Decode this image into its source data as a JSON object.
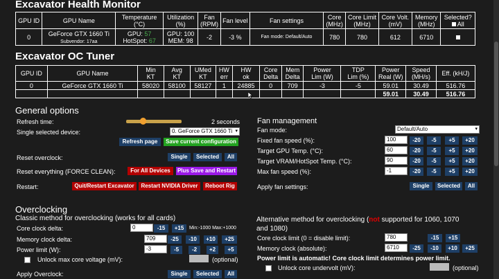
{
  "health": {
    "title": "Excavator Health Monitor",
    "headers": [
      "GPU ID",
      "GPU Name",
      "Temperature",
      "(°C)",
      "Utilization",
      "(%)",
      "Fan",
      "(RPM)",
      "Fan level",
      "Fan settings",
      "Core",
      "(MHz)",
      "Core Limit",
      "(MHz)",
      "Core Volt.",
      "(mV)",
      "Memory",
      "(MHz)",
      "Selected?",
      "All"
    ],
    "row": {
      "gpu_id": "0",
      "gpu_name": "GeForce GTX 1660 Ti",
      "subvendor": "Subvendor: 17aa",
      "temp_gpu_label": "GPU:",
      "temp_gpu_value": "57",
      "temp_hotspot_label": "HotSpot:",
      "temp_hotspot_value": "67",
      "util_gpu": "GPU: 100",
      "util_mem": "MEM: 98",
      "fan_rpm": "-2",
      "fan_level": "-3 %",
      "fan_settings": "Fan mode: Default/Auto",
      "core": "780",
      "core_limit": "780",
      "core_volt": "612",
      "memory": "6710"
    }
  },
  "oc_tuner": {
    "title": "Excavator OC Tuner",
    "headers": [
      "GPU ID",
      "GPU Name",
      "Min",
      "KT",
      "Avg",
      "KT",
      "UMed",
      "KT",
      "HW",
      "err",
      "HW",
      "ok",
      "Core",
      "Delta",
      "Mem",
      "Delta",
      "Power",
      "Lim (W)",
      "TDP",
      "Lim (%)",
      "Power",
      "Real (W)",
      "Speed",
      "(MH/s)",
      "Eff. (kH/J)"
    ],
    "row": [
      "0",
      "GeForce GTX 1660 Ti",
      "58020",
      "58100",
      "58127",
      "1",
      "24885",
      "0",
      "709",
      "-3",
      "-5",
      "59.01",
      "30.49",
      "516.76"
    ],
    "total": [
      "59.01",
      "30.49",
      "516.76"
    ]
  },
  "general": {
    "title": "General options",
    "refresh_label": "Refresh time:",
    "refresh_value": "2 seconds",
    "refresh_fraction": 0.28,
    "device_label": "Single selected device:",
    "device_value": "0. GeForce GTX 1660 Ti",
    "refresh_page": "Refresh page",
    "save_config": "Save current configuration",
    "reset_oc_label": "Reset overclock:",
    "single": "Single",
    "selected": "Selected",
    "all": "All",
    "reset_all_label": "Reset everything (FORCE CLEAN):",
    "for_all_devices": "For All Devices",
    "plus_save_restart": "Plus Save and Restart",
    "restart_label": "Restart:",
    "quit_restart": "Quit/Restart Excavator",
    "restart_nvidia": "Restart NVIDIA Driver",
    "reboot_rig": "Reboot Rig"
  },
  "fan": {
    "title": "Fan management",
    "mode_label": "Fan mode:",
    "mode_value": "Default/Auto",
    "fixed_label": "Fixed fan speed (%):",
    "fixed_value": "100",
    "gpu_temp_label": "Target GPU Temp. (°C):",
    "gpu_temp_value": "60",
    "vram_label": "Target VRAM/HotSpot Temp. (°C):",
    "vram_value": "90",
    "max_label": "Max fan speed (%):",
    "max_value": "-1",
    "steps": [
      "-20",
      "-5",
      "+5",
      "+20"
    ],
    "apply_label": "Apply fan settings:"
  },
  "overclocking": {
    "title": "Overclocking",
    "classic_title": "Classic method for overclocking (works for all cards)",
    "core_delta_label": "Core clock delta:",
    "core_delta_value": "0",
    "core_steps": [
      "-15",
      "+15"
    ],
    "core_range": "Min:-1000 Max:+1000",
    "mem_delta_label": "Memory clock delta:",
    "mem_delta_value": "709",
    "mem_steps": [
      "-25",
      "-10",
      "+10",
      "+25"
    ],
    "power_label": "Power limit (W):",
    "power_value": "-3",
    "power_steps": [
      "-5",
      "-2",
      "+2",
      "+5"
    ],
    "unlock_voltage_label": "Unlock max core voltage (mV):",
    "optional": "(optional)",
    "apply_label": "Apply Overclock:"
  },
  "alt": {
    "title_a": "Alternative method for overclocking (",
    "title_not": "not",
    "title_b": " supported for 1060, 1070",
    "title_c": "and 1080)",
    "core_limit_label": "Core clock limit (0 = disable limit):",
    "core_limit_value": "780",
    "core_steps": [
      "-15",
      "+15"
    ],
    "mem_label": "Memory clock (absolute):",
    "mem_value": "6710",
    "mem_steps": [
      "-25",
      "-10",
      "+10",
      "+25"
    ],
    "power_note": "Power limit is automatic! Core clock limit determines power limit.",
    "undervolt_label": "Unlock core undervolt (mV):",
    "optional": "(optional)"
  }
}
